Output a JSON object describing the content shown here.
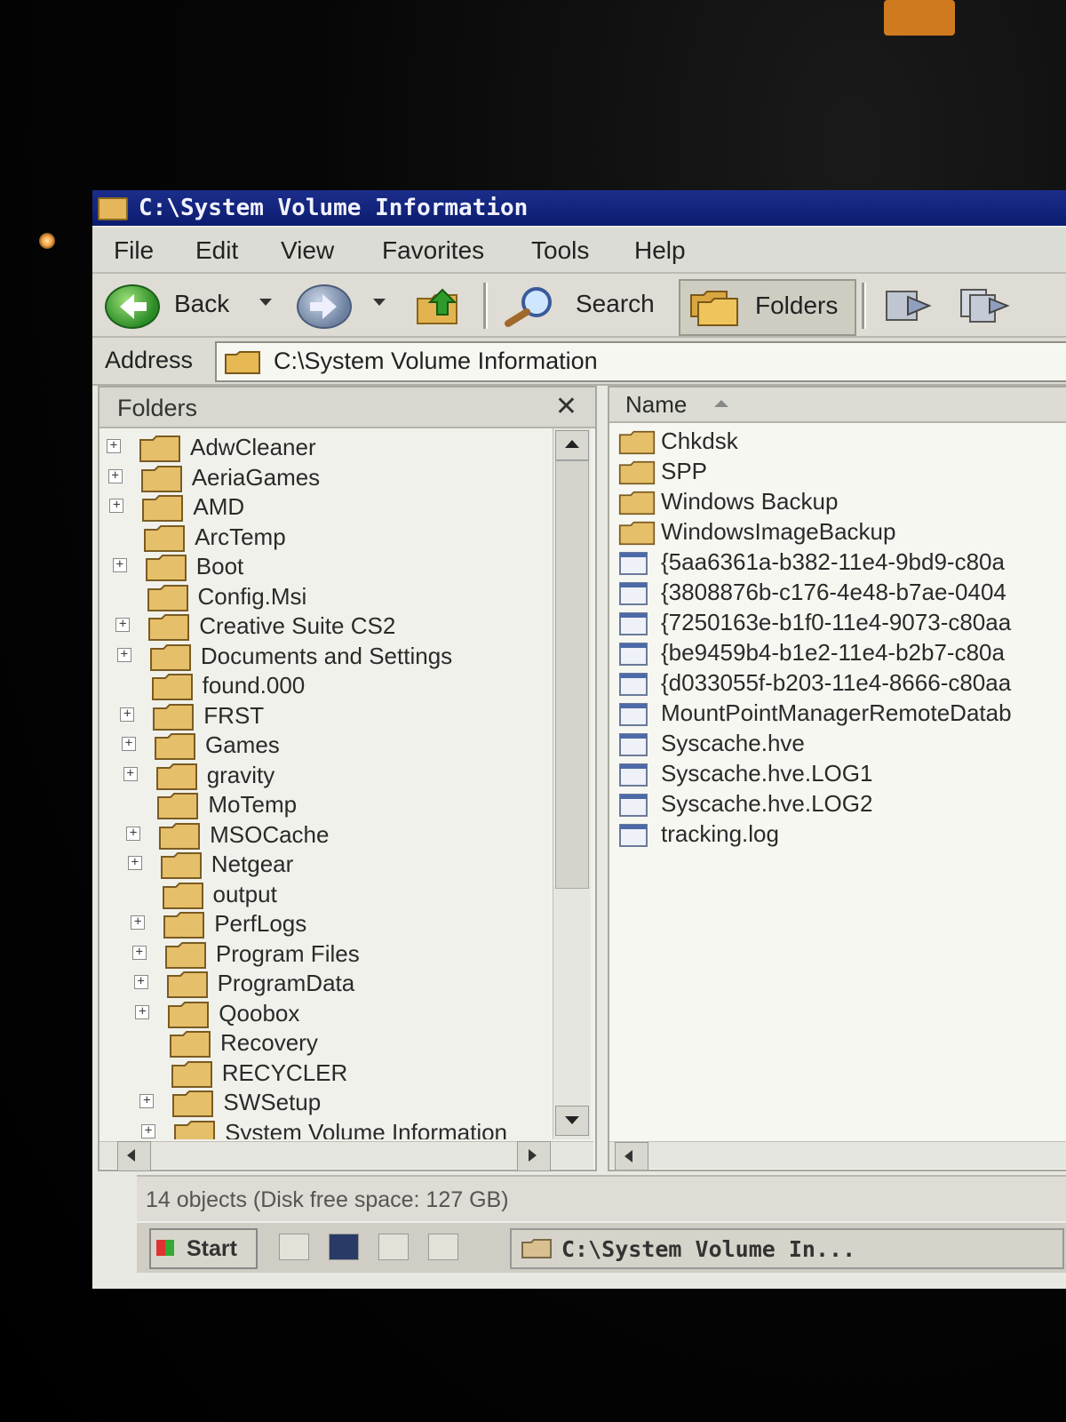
{
  "window": {
    "title": "C:\\System Volume Information"
  },
  "menu": [
    "File",
    "Edit",
    "View",
    "Favorites",
    "Tools",
    "Help"
  ],
  "toolbar": {
    "back_label": "Back",
    "search_label": "Search",
    "folders_label": "Folders",
    "icons": [
      "back-arrow",
      "forward-arrow",
      "up-folder",
      "search-magnifier",
      "folders",
      "move-to",
      "copy-to"
    ]
  },
  "address": {
    "label": "Address",
    "value": "C:\\System Volume Information"
  },
  "folders_pane": {
    "title": "Folders",
    "items": [
      {
        "label": "AdwCleaner",
        "expandable": true
      },
      {
        "label": "AeriaGames",
        "expandable": true
      },
      {
        "label": "AMD",
        "expandable": true
      },
      {
        "label": "ArcTemp",
        "expandable": false
      },
      {
        "label": "Boot",
        "expandable": true
      },
      {
        "label": "Config.Msi",
        "expandable": false
      },
      {
        "label": "Creative Suite CS2",
        "expandable": true
      },
      {
        "label": "Documents and Settings",
        "expandable": true
      },
      {
        "label": "found.000",
        "expandable": false
      },
      {
        "label": "FRST",
        "expandable": true
      },
      {
        "label": "Games",
        "expandable": true
      },
      {
        "label": "gravity",
        "expandable": true
      },
      {
        "label": "MoTemp",
        "expandable": false
      },
      {
        "label": "MSOCache",
        "expandable": true
      },
      {
        "label": "Netgear",
        "expandable": true
      },
      {
        "label": "output",
        "expandable": false
      },
      {
        "label": "PerfLogs",
        "expandable": true
      },
      {
        "label": "Program Files",
        "expandable": true
      },
      {
        "label": "ProgramData",
        "expandable": true
      },
      {
        "label": "Qoobox",
        "expandable": true
      },
      {
        "label": "Recovery",
        "expandable": false
      },
      {
        "label": "RECYCLER",
        "expandable": false
      },
      {
        "label": "SWSetup",
        "expandable": true
      },
      {
        "label": "System Volume Information",
        "expandable": true
      }
    ]
  },
  "files_pane": {
    "column_name": "Name",
    "items": [
      {
        "label": "Chkdsk",
        "type": "folder"
      },
      {
        "label": "SPP",
        "type": "folder"
      },
      {
        "label": "Windows Backup",
        "type": "folder"
      },
      {
        "label": "WindowsImageBackup",
        "type": "folder"
      },
      {
        "label": "{5aa6361a-b382-11e4-9bd9-c80a",
        "type": "file"
      },
      {
        "label": "{3808876b-c176-4e48-b7ae-0404",
        "type": "file"
      },
      {
        "label": "{7250163e-b1f0-11e4-9073-c80aa",
        "type": "file"
      },
      {
        "label": "{be9459b4-b1e2-11e4-b2b7-c80a",
        "type": "file"
      },
      {
        "label": "{d033055f-b203-11e4-8666-c80aa",
        "type": "file"
      },
      {
        "label": "MountPointManagerRemoteDatab",
        "type": "file"
      },
      {
        "label": "Syscache.hve",
        "type": "file"
      },
      {
        "label": "Syscache.hve.LOG1",
        "type": "file"
      },
      {
        "label": "Syscache.hve.LOG2",
        "type": "file"
      },
      {
        "label": "tracking.log",
        "type": "file"
      }
    ]
  },
  "status": {
    "text": "14 objects (Disk free space: 127 GB)"
  },
  "taskbar": {
    "start_label": "Start",
    "task_label": "C:\\System Volume In..."
  }
}
